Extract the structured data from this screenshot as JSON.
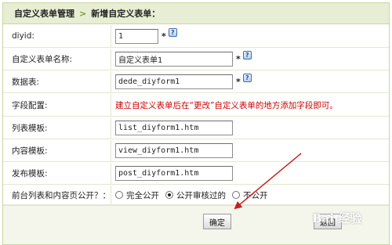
{
  "breadcrumb": {
    "parent": "自定义表单管理",
    "separator": ">",
    "current": "新增自定义表单："
  },
  "fields": [
    {
      "label": "diyid:",
      "value": "1",
      "required": "*",
      "help": "?"
    },
    {
      "label": "自定义表单名称:",
      "value": "自定义表单1",
      "required": "*",
      "help": "?"
    },
    {
      "label": "数据表:",
      "value": "dede_diyform1",
      "required": "*",
      "help": "?"
    },
    {
      "label": "字段配置:",
      "note": "建立自定义表单后在“更改”自定义表单的地方添加字段即可。"
    },
    {
      "label": "列表模板:",
      "value": "list_diyform1.htm"
    },
    {
      "label": "内容模板:",
      "value": "view_diyform1.htm"
    },
    {
      "label": "发布模板:",
      "value": "post_diyform1.htm"
    }
  ],
  "public": {
    "label": "前台列表和内容页公开？：",
    "options": [
      "完全公开",
      "公开审核过的",
      "不公开"
    ],
    "selected": "公开审核过的"
  },
  "buttons": {
    "confirm": "确定",
    "back": "返回"
  },
  "watermark": "Bai 经验",
  "colors": {
    "header_bg": "#e7eed3",
    "border": "#c8d6a4",
    "note_red": "#cc0000",
    "arrow_red": "#c62020"
  }
}
